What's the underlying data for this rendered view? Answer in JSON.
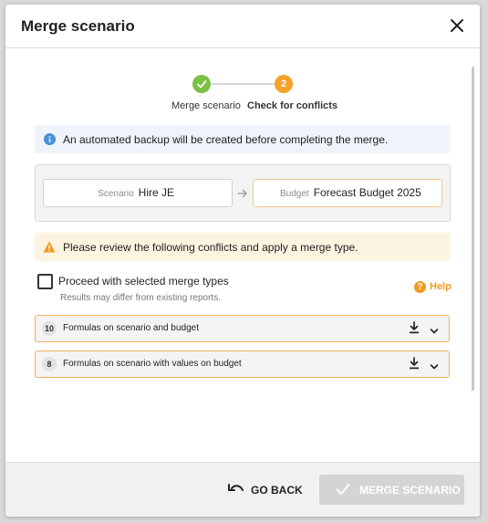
{
  "dialog": {
    "title": "Merge scenario",
    "close_icon": "close-icon"
  },
  "stepper": {
    "steps": [
      {
        "label": "Merge scenario",
        "state": "done",
        "marker": "✓"
      },
      {
        "label": "Check for conflicts",
        "state": "active",
        "marker": "2"
      }
    ],
    "colors": {
      "done": "#7bc144",
      "active": "#f5a12b"
    }
  },
  "info": {
    "icon": "info-icon",
    "text": "An automated backup will be created before completing the merge."
  },
  "flow": {
    "source_label": "Scenario",
    "source_value": "Hire JE",
    "arrow_icon": "arrow-right-icon",
    "target_label": "Budget",
    "target_value": "Forecast Budget 2025"
  },
  "warning": {
    "icon": "warning-icon",
    "text": "Please review the following conflicts and apply a merge type."
  },
  "options": {
    "checkbox_label": "Proceed with selected merge types",
    "checkbox_checked": false,
    "hint": "Results may differ from existing reports.",
    "help_label": "Help",
    "help_icon": "help-icon"
  },
  "conflicts": [
    {
      "count": "10",
      "label": "Formulas on scenario and budget"
    },
    {
      "count": "8",
      "label": "Formulas on scenario with values on budget"
    }
  ],
  "footer": {
    "go_back_label": "GO BACK",
    "go_back_icon": "undo-icon",
    "merge_label": "MERGE SCENARIO",
    "merge_icon": "check-icon",
    "merge_enabled": false
  }
}
